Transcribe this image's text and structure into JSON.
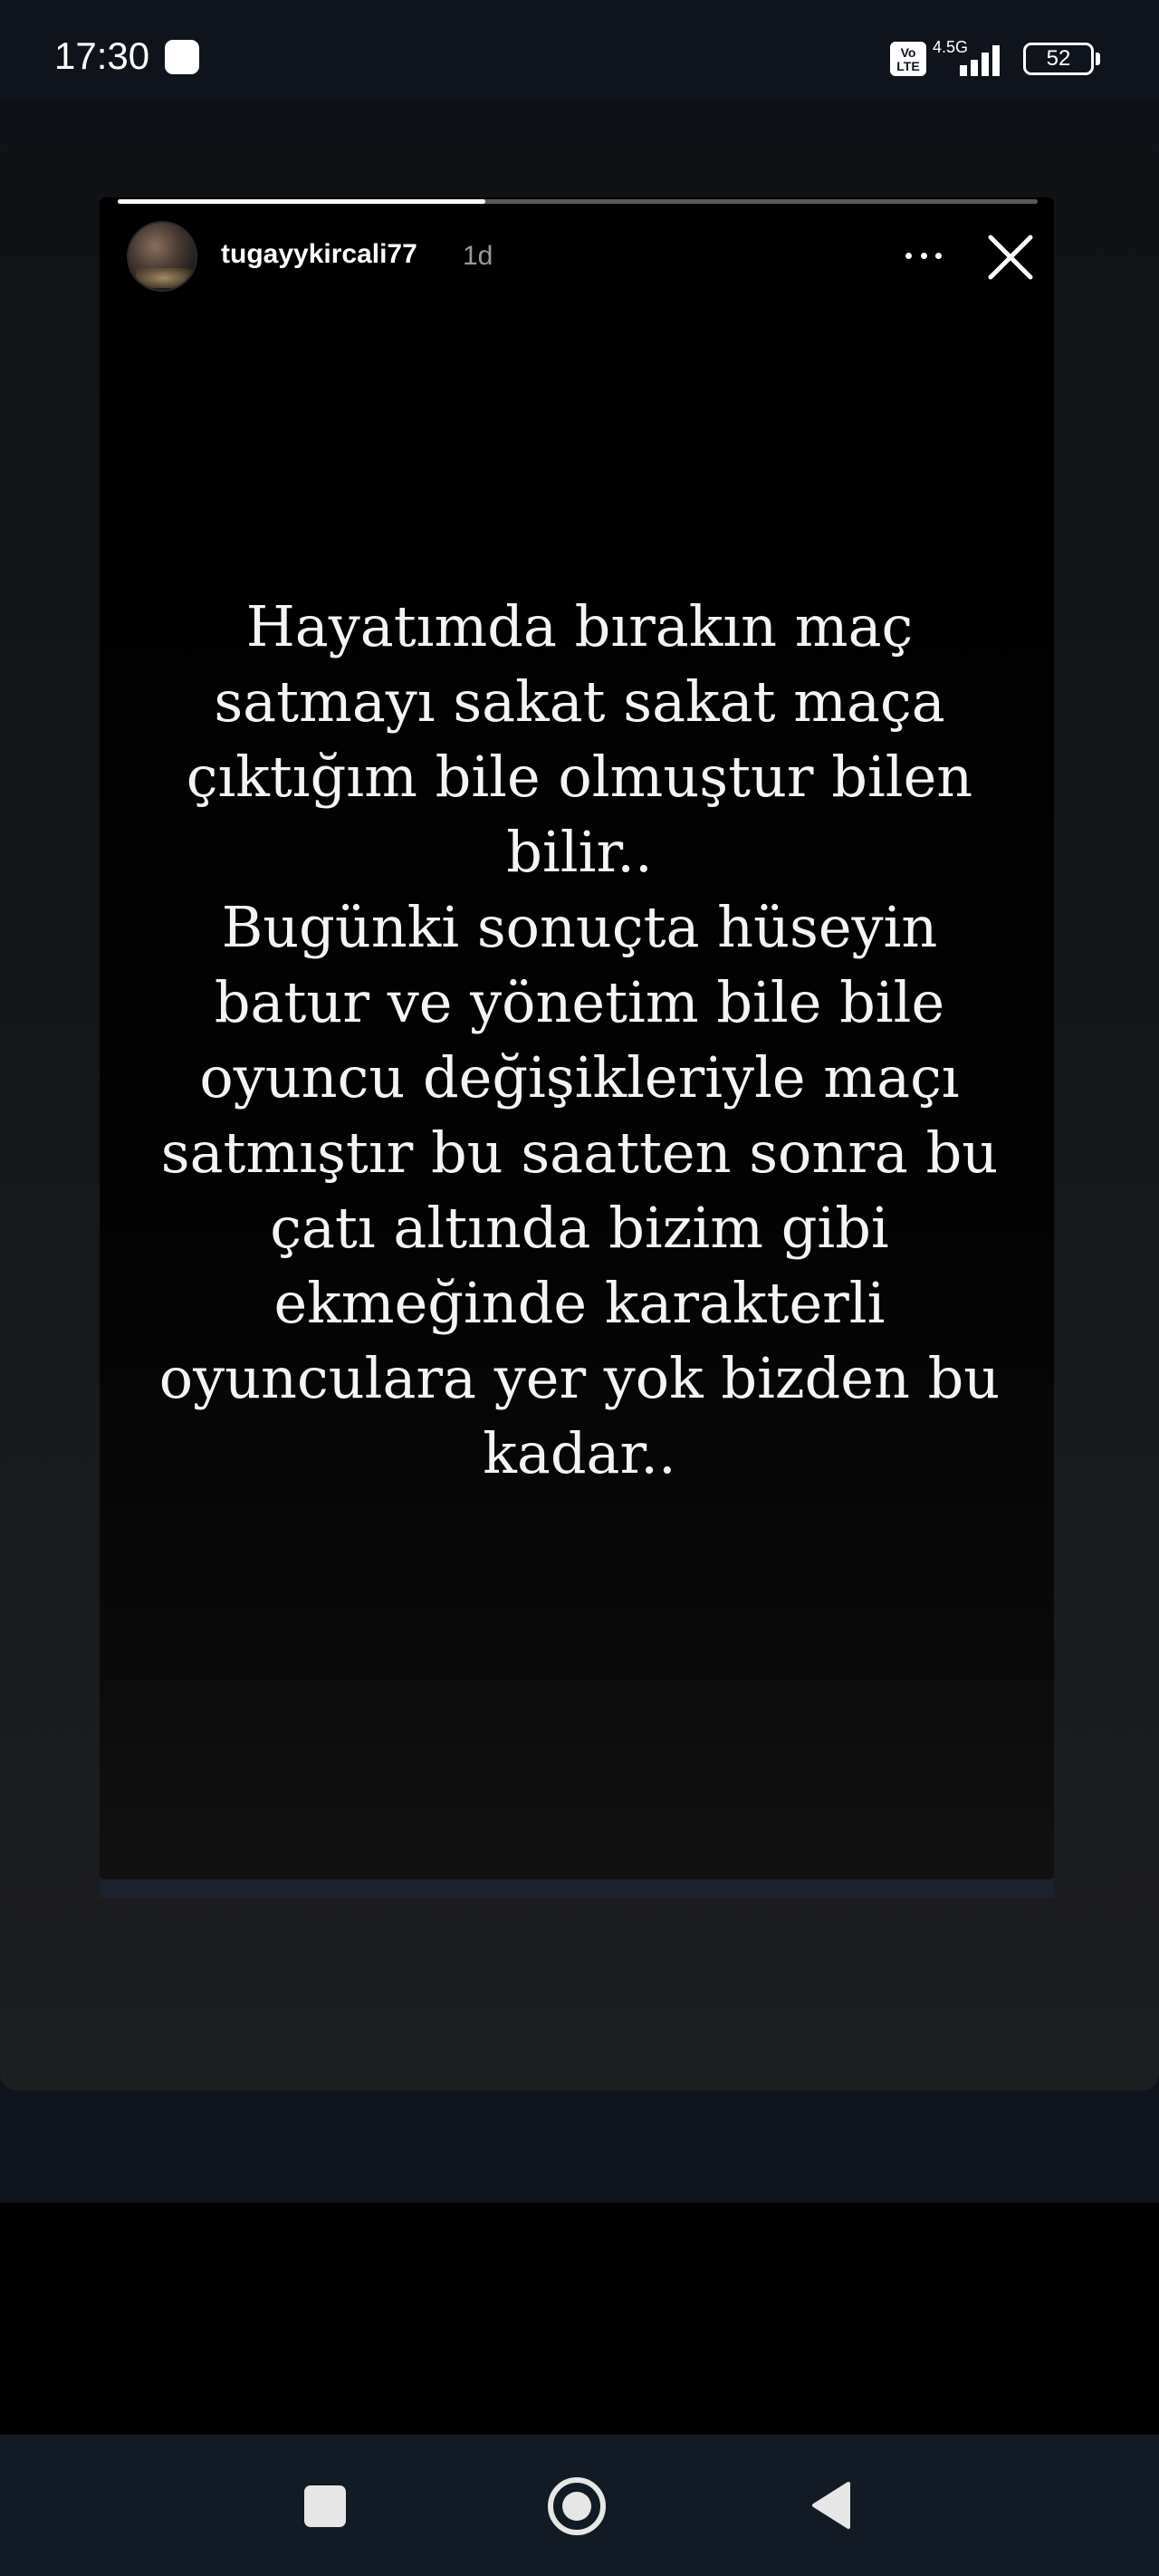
{
  "status_bar": {
    "time": "17:30",
    "volte_label": "Vo LTE",
    "network_type": "4.5G",
    "battery_level": "52"
  },
  "story": {
    "username": "tugayykircali77",
    "post_age": "1d",
    "progress": 0.4,
    "text": "Hayatımda bırakın maç\nsatmayı sakat sakat maça\nçıktığım bile olmuştur bilen\nbilir..\nBugünki sonuçta hüseyin\nbatur ve yönetim bile bile\noyuncu değişikleriyle maçı\nsatmıştır bu saatten sonra bu\nçatı altında bizim gibi\nekmeğinde karakterli\noyunculara yer yok bizden bu\nkadar.."
  },
  "icons": {
    "more": "more-icon",
    "close": "close-icon",
    "nav_recents": "square-icon",
    "nav_home": "circle-icon",
    "nav_back": "triangle-back-icon"
  },
  "colors": {
    "status_bar_bg": "#0f131b",
    "story_bg": "#000000",
    "nav_bar_bg": "#121a25",
    "text": "#ffffff"
  }
}
